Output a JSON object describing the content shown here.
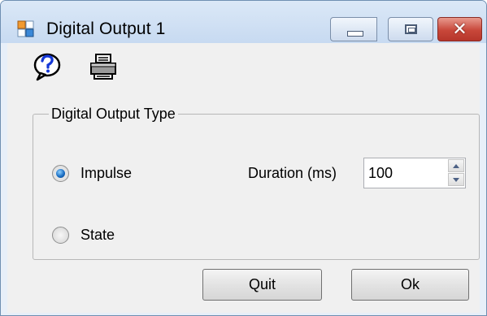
{
  "window": {
    "title": "Digital Output 1",
    "title_icon": "app-window-icon",
    "controls": {
      "minimize": "minimize-icon",
      "maximize": "maximize-icon",
      "close": "✕"
    }
  },
  "toolbar": {
    "help_icon": "help-icon",
    "print_icon": "printer-icon"
  },
  "group": {
    "title": "Digital Output Type",
    "options": [
      {
        "label": "Impulse",
        "selected": true
      },
      {
        "label": "State",
        "selected": false
      }
    ],
    "duration": {
      "label": "Duration (ms)",
      "value": "100"
    }
  },
  "buttons": {
    "quit": "Quit",
    "ok": "Ok"
  },
  "colors": {
    "titlebar": "#dbe8f7",
    "close_button": "#c8473a",
    "radio_selected": "#1b6fc4",
    "client_bg": "#f0f0f0"
  }
}
